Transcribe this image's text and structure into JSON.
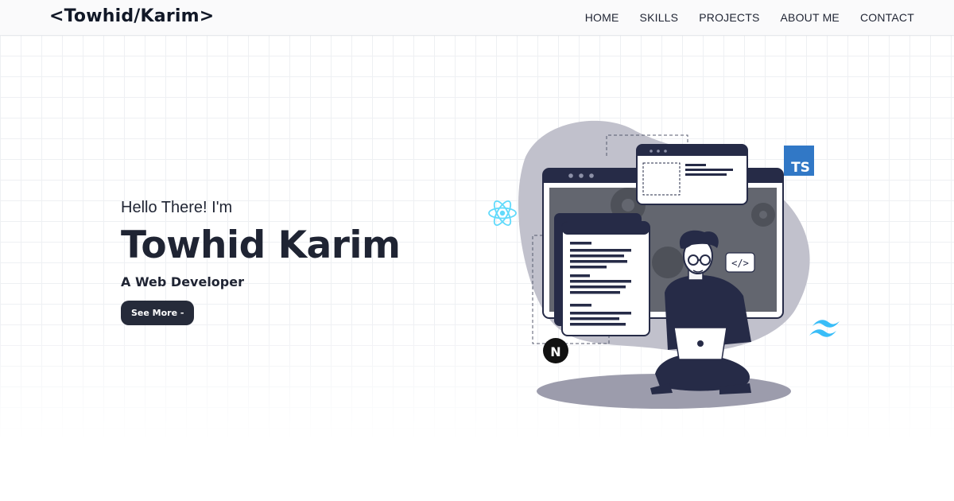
{
  "header": {
    "logo": "<Towhid/Karim>",
    "nav": [
      {
        "label": "HOME"
      },
      {
        "label": "SKILLS"
      },
      {
        "label": "PROJECTS"
      },
      {
        "label": "ABOUT ME"
      },
      {
        "label": "CONTACT"
      }
    ]
  },
  "hero": {
    "greeting": "Hello There! I'm",
    "name": "Towhid Karim",
    "role": "A Web Developer",
    "cta_label": "See More -"
  },
  "illustration": {
    "badge_ts": "TS",
    "badge_next": "N",
    "code_tag": "</>",
    "icons": [
      "react-icon",
      "typescript-icon",
      "nextjs-icon",
      "tailwind-icon",
      "code-tag-icon"
    ],
    "colors": {
      "dark_navy": "#262b47",
      "blob_gray": "#c1c1cc",
      "react_blue": "#61dafb",
      "ts_blue": "#3178c6",
      "tailwind_blue": "#38bdf8"
    }
  }
}
